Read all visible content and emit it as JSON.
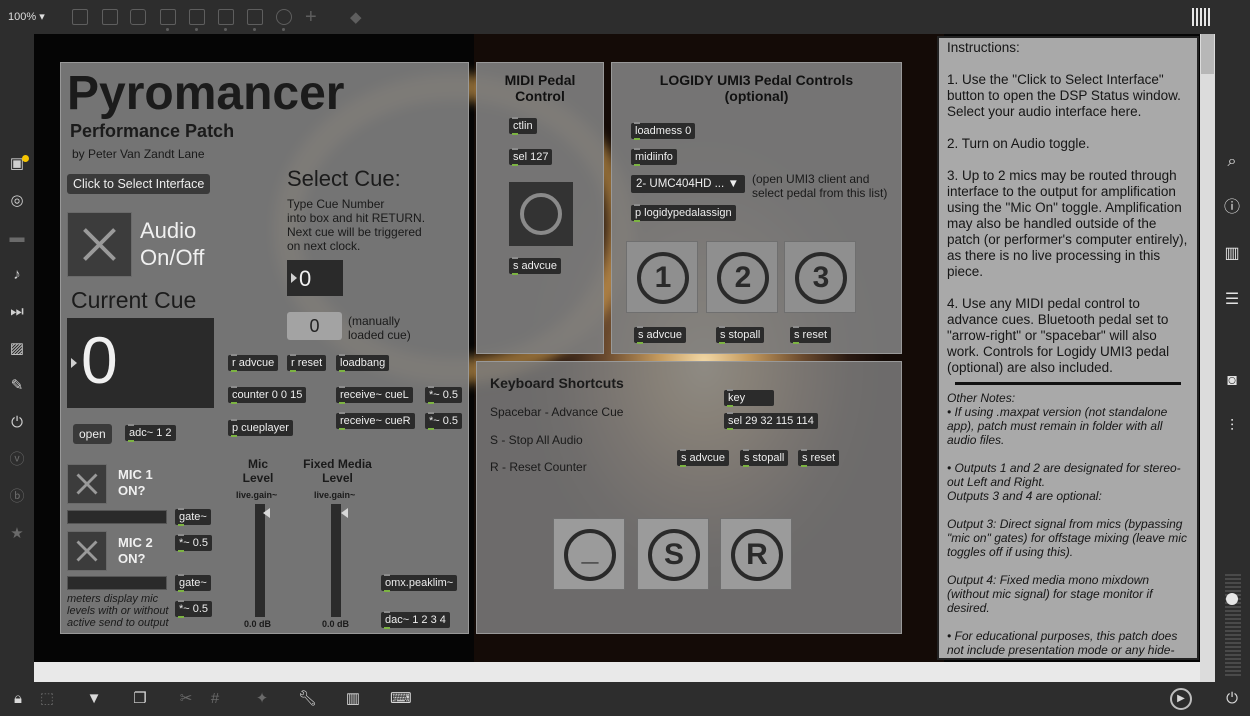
{
  "toolbar": {
    "zoom": "100%"
  },
  "patch": {
    "title": "Pyromancer",
    "subtitle": "Performance Patch",
    "author": "by Peter Van Zandt Lane",
    "select_interface": "Click to Select Interface",
    "audio_onoff": [
      "Audio",
      "On/Off"
    ],
    "current_cue_label": "Current Cue",
    "current_cue_value": "0",
    "open_btn": "open",
    "adc": "adc~ 1 2",
    "select_cue_title": "Select Cue:",
    "select_cue_help": [
      "Type Cue Number",
      "into box and hit RETURN.",
      "Next cue will be triggered",
      "on next clock."
    ],
    "select_cue_value": "0",
    "manual_cue_value": "0",
    "manual_cue_note": [
      "(manually",
      "loaded cue)"
    ],
    "r_advcue": "r advcue",
    "r_reset": "r reset",
    "loadbang": "loadbang",
    "counter": "counter 0 0 15",
    "receive_cuel": "receive~ cueL",
    "receive_cuer": "receive~ cueR",
    "mul05": "*~ 0.5",
    "p_cueplayer": "p cueplayer",
    "mic1": [
      "MIC 1",
      "ON?"
    ],
    "mic2": [
      "MIC 2",
      "ON?"
    ],
    "gate": "gate~",
    "meters_note": [
      "meters display mic",
      "levels with or without",
      "active send to output"
    ],
    "mic_level": [
      "Mic",
      "Level"
    ],
    "fixed_media_level": [
      "Fixed Media",
      "Level"
    ],
    "live_gain": "live.gain~",
    "db_value": "0.0 dB",
    "peaklim": "omx.peaklim~",
    "dac": "dac~ 1 2 3 4"
  },
  "midi": {
    "title": [
      "MIDI Pedal",
      "Control"
    ],
    "ctlin": "ctlin",
    "sel": "sel 127",
    "send": "s advcue"
  },
  "logidy": {
    "title": [
      "LOGIDY UMI3 Pedal Controls",
      "(optional)"
    ],
    "loadmess": "loadmess 0",
    "midiinfo": "midiinfo",
    "device": "2- UMC404HD ...",
    "device_note": [
      "(open UMI3 client and",
      "select pedal from this list)"
    ],
    "assign": "p logidypedalassign",
    "buttons": [
      "1",
      "2",
      "3"
    ],
    "sends": [
      "s advcue",
      "s stopall",
      "s reset"
    ]
  },
  "keyboard": {
    "title": "Keyboard Shortcuts",
    "shortcuts": [
      "Spacebar - Advance Cue",
      "S - Stop All Audio",
      "R - Reset Counter"
    ],
    "key": "key",
    "sel": "sel 29 32 115 114",
    "sends": [
      "s advcue",
      "s stopall",
      "s reset"
    ],
    "buttons": [
      "_",
      "S",
      "R"
    ]
  },
  "instructions": {
    "heading": "Instructions:",
    "steps": [
      "1. Use the \"Click to Select Interface\" button to open the DSP Status window. Select your audio interface here.",
      "2. Turn on Audio toggle.",
      "3. Up to 2 mics may be routed through interface to the output for amplification using the \"Mic On\" toggle. Amplification may also be handled outside of the patch (or performer's computer entirely), as there is no live processing in this piece.",
      "4. Use any MIDI pedal control to advance cues. Bluetooth pedal set to \"arrow-right\" or \"spacebar\" will also work. Controls for Logidy UMI3 pedal (optional) are also included."
    ],
    "notes": [
      "Other Notes:\n• If using .maxpat version (not standalone app), patch must remain in folder with all audio files.",
      "• Outputs 1 and 2 are designated for stereo-out Left and Right.\nOutputs 3 and 4 are optional:",
      "Output 3: Direct signal from mics (bypassing \"mic on\" gates) for offstage mixing (leave mic toggles off if using this).",
      "Output 4: Fixed media mono mixdown (without mic signal) for stage monitor if desired.",
      "• For educational purposes, this patch does not include presentation mode or any hide-on-lock objects."
    ]
  },
  "colors": {
    "panel": "#7d7d7d",
    "object": "#2b2b2b",
    "instructions_bg": "#a9a9a9",
    "toolbar": "#2d2d2d"
  }
}
